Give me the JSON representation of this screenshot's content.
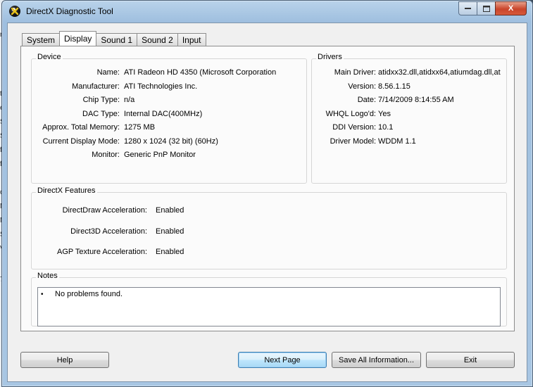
{
  "window": {
    "title": "DirectX Diagnostic Tool",
    "caption_close": "X"
  },
  "tabs": [
    {
      "label": "System"
    },
    {
      "label": "Display"
    },
    {
      "label": "Sound 1"
    },
    {
      "label": "Sound 2"
    },
    {
      "label": "Input"
    }
  ],
  "device": {
    "legend": "Device",
    "rows": [
      {
        "label": "Name:",
        "value": "ATI Radeon HD 4350 (Microsoft Corporation"
      },
      {
        "label": "Manufacturer:",
        "value": "ATI Technologies Inc."
      },
      {
        "label": "Chip Type:",
        "value": "n/a"
      },
      {
        "label": "DAC Type:",
        "value": "Internal DAC(400MHz)"
      },
      {
        "label": "Approx. Total Memory:",
        "value": "1275 MB"
      },
      {
        "label": "Current Display Mode:",
        "value": "1280 x 1024 (32 bit) (60Hz)"
      },
      {
        "label": "Monitor:",
        "value": "Generic PnP Monitor"
      }
    ]
  },
  "drivers": {
    "legend": "Drivers",
    "rows": [
      {
        "label": "Main Driver:",
        "value": "atidxx32.dll,atidxx64,atiumdag.dll,at"
      },
      {
        "label": "Version:",
        "value": "8.56.1.15"
      },
      {
        "label": "Date:",
        "value": "7/14/2009 8:14:55 AM"
      },
      {
        "label": "WHQL Logo'd:",
        "value": "Yes"
      },
      {
        "label": "DDI Version:",
        "value": "10.1"
      },
      {
        "label": "Driver Model:",
        "value": "WDDM 1.1"
      }
    ]
  },
  "features": {
    "legend": "DirectX Features",
    "rows": [
      {
        "label": "DirectDraw Acceleration:",
        "value": "Enabled"
      },
      {
        "label": "Direct3D Acceleration:",
        "value": "Enabled"
      },
      {
        "label": "AGP Texture Acceleration:",
        "value": "Enabled"
      }
    ]
  },
  "notes": {
    "legend": "Notes",
    "bullet": "•",
    "items": [
      "No problems found."
    ]
  },
  "buttons": {
    "help": "Help",
    "next_page": "Next Page",
    "save_all": "Save All Information...",
    "exit": "Exit"
  },
  "background_window": {
    "fragments": [
      "n,",
      "te",
      "er",
      "S",
      "S",
      "fe",
      "fa",
      "o",
      "Mi",
      "Mi",
      "S",
      "V",
      "7"
    ]
  }
}
